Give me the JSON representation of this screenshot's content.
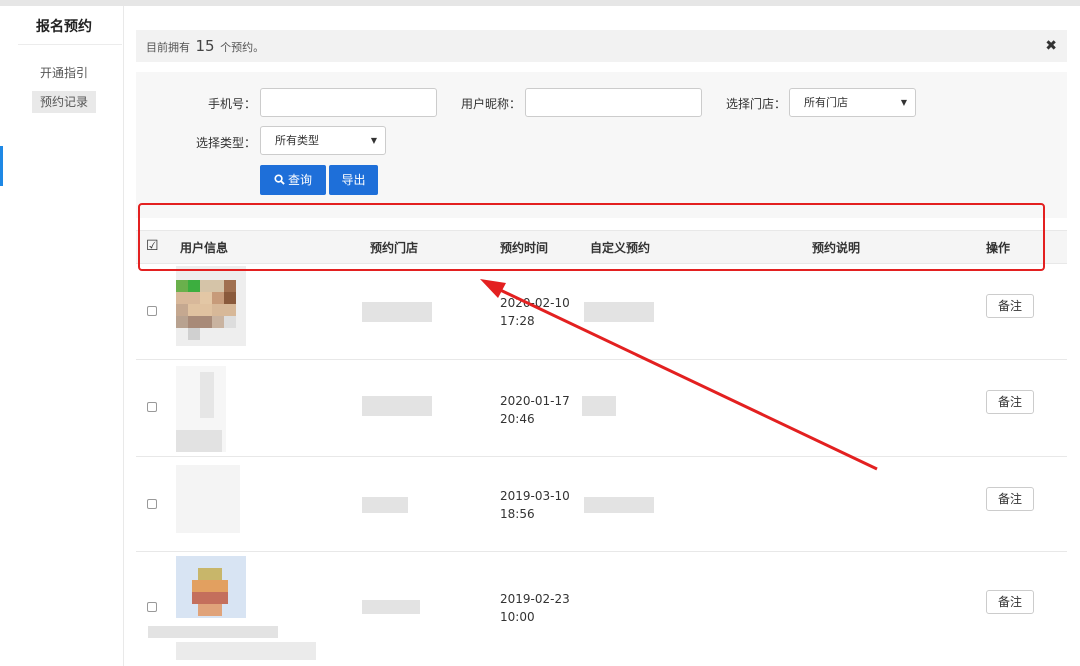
{
  "sidebar": {
    "title": "报名预约",
    "items": [
      {
        "label": "开通指引",
        "active": false
      },
      {
        "label": "预约记录",
        "active": true
      }
    ]
  },
  "alert": {
    "prefix": "目前拥有",
    "count": "15",
    "suffix": "个预约。",
    "close_icon": "close-icon"
  },
  "filter": {
    "phone_label": "手机号：",
    "phone_value": "",
    "nickname_label": "用户昵称：",
    "nickname_value": "",
    "store_label": "选择门店：",
    "store_selected": "所有门店",
    "type_label": "选择类型：",
    "type_selected": "所有类型",
    "query_label": "查询",
    "export_label": "导出"
  },
  "table": {
    "headers": [
      "用户信息",
      "预约门店",
      "预约时间",
      "自定义预约",
      "预约说明",
      "操作"
    ],
    "rows": [
      {
        "time_date": "2020-02-10",
        "time_clock": "17:28",
        "action": "备注"
      },
      {
        "time_date": "2020-01-17",
        "time_clock": "20:46",
        "action": "备注"
      },
      {
        "time_date": "2019-03-10",
        "time_clock": "18:56",
        "action": "备注"
      },
      {
        "time_date": "2019-02-23",
        "time_clock": "10:00",
        "action": "备注"
      }
    ]
  },
  "colors": {
    "accent": "#1e6fd9",
    "annotation": "#e32020"
  }
}
